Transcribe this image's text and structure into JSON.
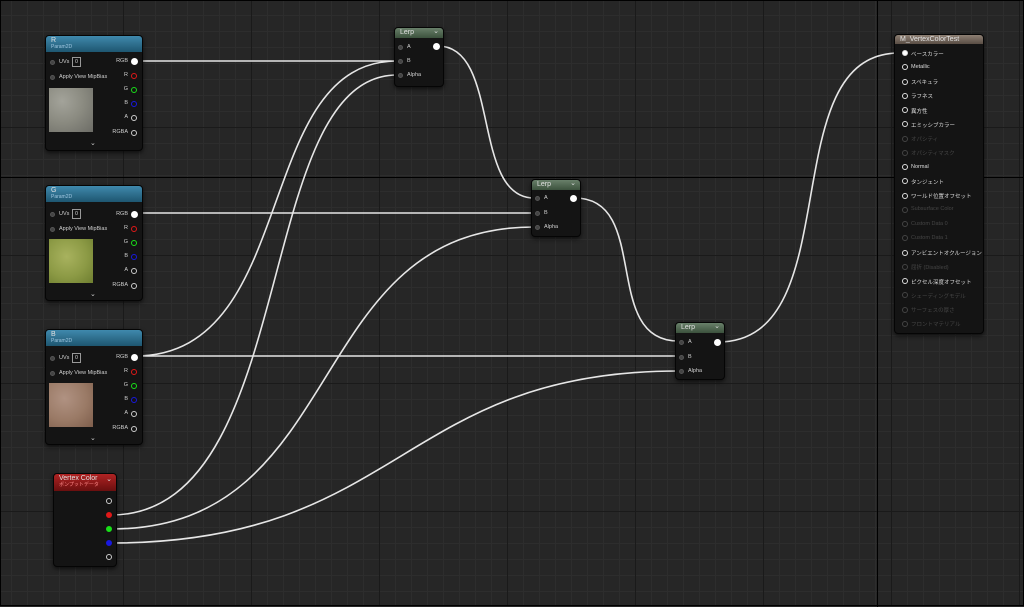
{
  "texture_nodes": [
    {
      "title": "R",
      "subtitle": "Param2D",
      "uvs_label": "UVs",
      "uvs_value": "0",
      "mip_label": "Apply View MipBias",
      "outputs": [
        "RGB",
        "R",
        "G",
        "B",
        "A",
        "RGBA"
      ],
      "thumb_colors": [
        "#8a8a80",
        "#6c6c66",
        "#a3a39a"
      ]
    },
    {
      "title": "G",
      "subtitle": "Param2D",
      "uvs_label": "UVs",
      "uvs_value": "0",
      "mip_label": "Apply View MipBias",
      "outputs": [
        "RGB",
        "R",
        "G",
        "B",
        "A",
        "RGBA"
      ],
      "thumb_colors": [
        "#8c9a45",
        "#6e7e30",
        "#a8b25e"
      ]
    },
    {
      "title": "B",
      "subtitle": "Param2D",
      "uvs_label": "UVs",
      "uvs_value": "0",
      "mip_label": "Apply View MipBias",
      "outputs": [
        "RGB",
        "R",
        "G",
        "B",
        "A",
        "RGBA"
      ],
      "thumb_colors": [
        "#9a7a66",
        "#7e5e4c",
        "#b09282"
      ]
    }
  ],
  "lerp_nodes": [
    {
      "title": "Lerp",
      "inputs": [
        "A",
        "B",
        "Alpha"
      ]
    },
    {
      "title": "Lerp",
      "inputs": [
        "A",
        "B",
        "Alpha"
      ]
    },
    {
      "title": "Lerp",
      "inputs": [
        "A",
        "B",
        "Alpha"
      ]
    }
  ],
  "vertex_color": {
    "title": "Vertex Color",
    "subtitle": "ポンプットデータ"
  },
  "material": {
    "title": "M_VertexColorTest",
    "pins": [
      {
        "label": "ベースカラー",
        "active": true,
        "connected": true
      },
      {
        "label": "Metallic",
        "active": true,
        "connected": false
      },
      {
        "label": "スペキュラ",
        "active": true,
        "connected": false
      },
      {
        "label": "ラフネス",
        "active": true,
        "connected": false
      },
      {
        "label": "異方性",
        "active": true,
        "connected": false
      },
      {
        "label": "エミッシブカラー",
        "active": true,
        "connected": false
      },
      {
        "label": "オパシティ",
        "active": false,
        "connected": false
      },
      {
        "label": "オパシティマスク",
        "active": false,
        "connected": false
      },
      {
        "label": "Normal",
        "active": true,
        "connected": false
      },
      {
        "label": "タンジェント",
        "active": true,
        "connected": false
      },
      {
        "label": "ワールド位置オフセット",
        "active": true,
        "connected": false
      },
      {
        "label": "Subsurface Color",
        "active": false,
        "connected": false
      },
      {
        "label": "Custom Data 0",
        "active": false,
        "connected": false
      },
      {
        "label": "Custom Data 1",
        "active": false,
        "connected": false
      },
      {
        "label": "アンビエントオクルージョン",
        "active": true,
        "connected": false
      },
      {
        "label": "屈折 (Disabled)",
        "active": false,
        "connected": false
      },
      {
        "label": "ピクセル深度オフセット",
        "active": true,
        "connected": false
      },
      {
        "label": "シェーディングモデル",
        "active": false,
        "connected": false
      },
      {
        "label": "サーフェスの厚さ",
        "active": false,
        "connected": false
      },
      {
        "label": "フロントマテリアル",
        "active": false,
        "connected": false
      }
    ]
  },
  "colors": {
    "wire": "#e6e6e6",
    "grid": "#262626",
    "texture_header": "#2f7396",
    "lerp_header": "#556b56",
    "vertex_header": "#9a1b1b",
    "material_header": "#7a6c61"
  }
}
